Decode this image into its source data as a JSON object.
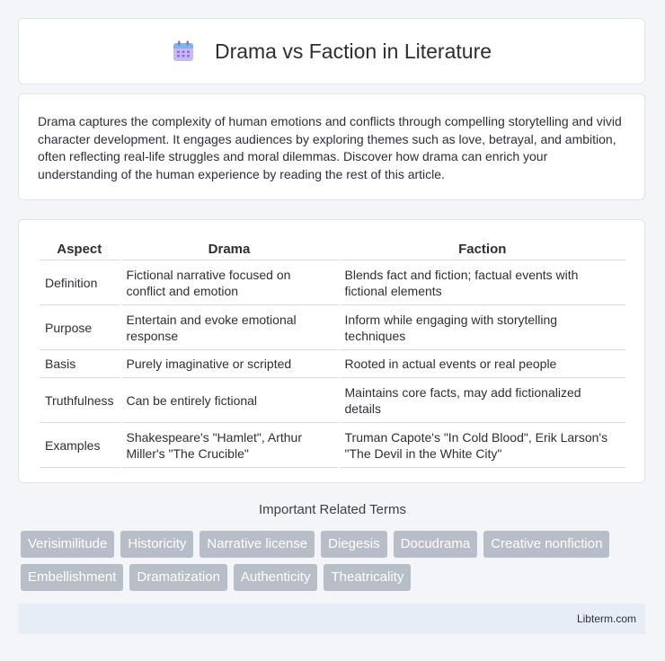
{
  "header": {
    "title": "Drama vs Faction in Literature",
    "icon": "calendar-icon"
  },
  "intro": {
    "text": "Drama captures the complexity of human emotions and conflicts through compelling storytelling and vivid character development. It engages audiences by exploring themes such as love, betrayal, and ambition, often reflecting real-life struggles and moral dilemmas. Discover how drama can enrich your understanding of the human experience by reading the rest of this article."
  },
  "table": {
    "columns": [
      "Aspect",
      "Drama",
      "Faction"
    ],
    "rows": [
      [
        "Definition",
        "Fictional narrative focused on conflict and emotion",
        "Blends fact and fiction; factual events with fictional elements"
      ],
      [
        "Purpose",
        "Entertain and evoke emotional response",
        "Inform while engaging with storytelling techniques"
      ],
      [
        "Basis",
        "Purely imaginative or scripted",
        "Rooted in actual events or real people"
      ],
      [
        "Truthfulness",
        "Can be entirely fictional",
        "Maintains core facts, may add fictionalized details"
      ],
      [
        "Examples",
        "Shakespeare's \"Hamlet\", Arthur Miller's \"The Crucible\"",
        "Truman Capote's \"In Cold Blood\", Erik Larson's \"The Devil in the White City\""
      ]
    ]
  },
  "related": {
    "title": "Important Related Terms",
    "tags": [
      "Verisimilitude",
      "Historicity",
      "Narrative license",
      "Diegesis",
      "Docudrama",
      "Creative nonfiction",
      "Embellishment",
      "Dramatization",
      "Authenticity",
      "Theatricality"
    ]
  },
  "footer": {
    "text": "Libterm.com"
  },
  "colors": {
    "tag_bg": "#b8bec8",
    "footer_bg": "#e7edf7",
    "page_bg": "#f3f5f9"
  }
}
